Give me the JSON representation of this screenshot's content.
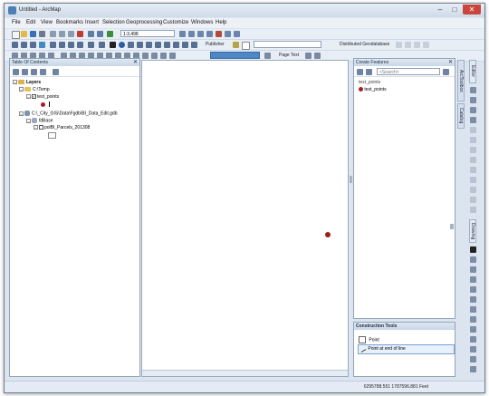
{
  "window": {
    "title": "Untitled - ArcMap"
  },
  "menu": [
    "File",
    "Edit",
    "View",
    "Bookmarks",
    "Insert",
    "Selection",
    "Geoprocessing",
    "Customize",
    "Windows",
    "Help"
  ],
  "toolbar": {
    "scale": "1:3,498",
    "publisher": "Publisher",
    "page_text": "Page Text",
    "distributed_geodatabase": "Distributed Geodatabase"
  },
  "toc": {
    "title": "Table Of Contents",
    "layers_label": "Layers",
    "folder1": "C:\\Temp",
    "layer1": "test_points",
    "folder2": "C:\\_City_GIS\\Data\\Fgdb\\BI_Data_Edit.gdb",
    "dataset": "fdBase",
    "layer2": "polBI_Parcels_201308"
  },
  "create_features": {
    "title": "Create Features",
    "search_placeholder": "<Search>",
    "group": "test_points",
    "item": "test_points"
  },
  "construction_tools": {
    "title": "Construction Tools",
    "items": [
      "Point",
      "Point at end of line"
    ]
  },
  "side_tabs": [
    "ArcToolbox",
    "Catalog"
  ],
  "right_toolbars": [
    "Editor",
    "Drawing"
  ],
  "status": {
    "coordinates": "6295788.551  1787596.881 Feet"
  }
}
